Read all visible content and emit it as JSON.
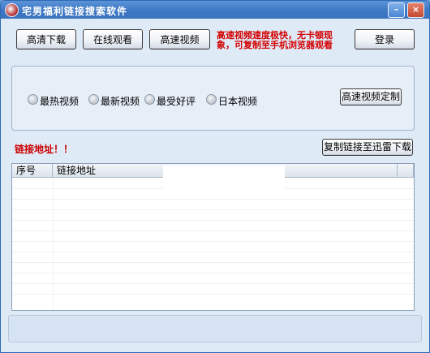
{
  "window": {
    "title": "宅男福利链接搜索软件",
    "minimize_label": "–",
    "close_label": "×"
  },
  "toolbar": {
    "hd_download_label": "高清下载",
    "online_watch_label": "在线观看",
    "fast_video_label": "高速视频",
    "login_label": "登录",
    "notice_line1": "高速视频速度极快，无卡顿现",
    "notice_line2": "象，可复制至手机浏览器观看"
  },
  "filters": {
    "options": [
      "最热视频",
      "最新视频",
      "最受好评",
      "日本视频"
    ],
    "custom_button_label": "高速视频定制"
  },
  "links": {
    "label": "链接地址！！",
    "copy_button_label": "复制链接至迅雷下载"
  },
  "table": {
    "columns": [
      "序号",
      "链接地址"
    ],
    "rows": []
  },
  "colors": {
    "titlebar": "#3d78c4",
    "notice_text": "#d40000",
    "link_label_text": "#cc0000",
    "window_bg": "#dfeaf7"
  }
}
